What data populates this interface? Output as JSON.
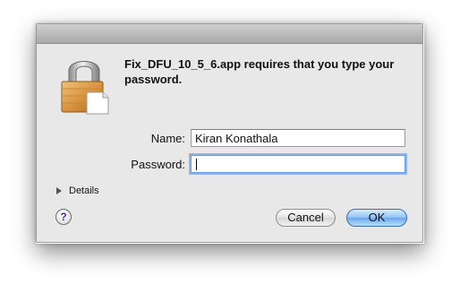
{
  "dialog": {
    "message": "Fix_DFU_10_5_6.app requires that you type your password.",
    "name_label": "Name:",
    "name_value": "Kiran Konathala",
    "password_label": "Password:",
    "password_value": "",
    "details_label": "Details",
    "help_label": "?",
    "cancel_label": "Cancel",
    "ok_label": "OK",
    "icon": "lock-icon"
  },
  "colors": {
    "dialog_bg": "#e8e8e8",
    "default_button": "#6ca6ea",
    "focus_ring": "#8fb6e8",
    "help_glyph": "#5a2a9c"
  }
}
